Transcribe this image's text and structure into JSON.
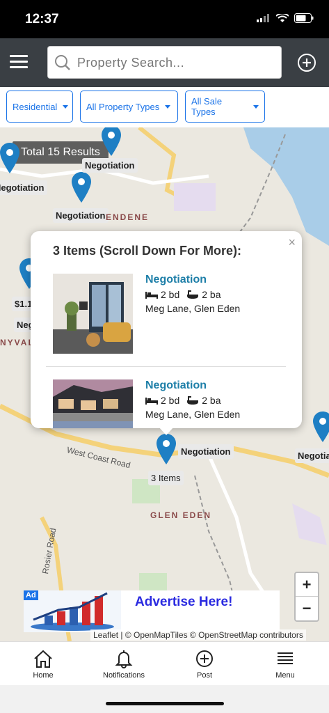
{
  "status": {
    "time": "12:37"
  },
  "header": {
    "search_placeholder": "Property Search..."
  },
  "filters": [
    {
      "label": "Residential"
    },
    {
      "label": "All Property Types"
    },
    {
      "label": "All Sale Types"
    }
  ],
  "map": {
    "results_badge": "Total 15 Results",
    "labels": [
      "Negotiation",
      "Negotiation",
      "Negotiation",
      "Negotiation",
      "Negotiation",
      "Negotiation",
      "3 Items",
      "$1.1",
      "Neg"
    ],
    "place_names": [
      "ENDENE",
      "NYVAL",
      "GLEN EDEN",
      "West Coast Road",
      "Rosier Road"
    ],
    "attribution": "Leaflet | © OpenMapTiles © OpenStreetMap contributors"
  },
  "popup": {
    "title": "3 Items (Scroll Down For More):",
    "close": "×",
    "items": [
      {
        "status": "Negotiation",
        "beds": "2 bd",
        "baths": "2 ba",
        "address": "Meg Lane, Glen Eden"
      },
      {
        "status": "Negotiation",
        "beds": "2 bd",
        "baths": "2 ba",
        "address": "Meg Lane, Glen Eden"
      }
    ]
  },
  "zoom": {
    "in": "+",
    "out": "−"
  },
  "ad": {
    "tag": "Ad",
    "text": "Advertise Here!"
  },
  "tabbar": {
    "items": [
      {
        "label": "Home",
        "icon": "home-icon"
      },
      {
        "label": "Notifications",
        "icon": "bell-icon"
      },
      {
        "label": "Post",
        "icon": "plus-circle-icon"
      },
      {
        "label": "Menu",
        "icon": "menu-icon"
      }
    ]
  },
  "colors": {
    "header": "#3a3f44",
    "accent": "#1a73e8",
    "pin": "#1e7fc4",
    "link": "#1e7fa8"
  }
}
